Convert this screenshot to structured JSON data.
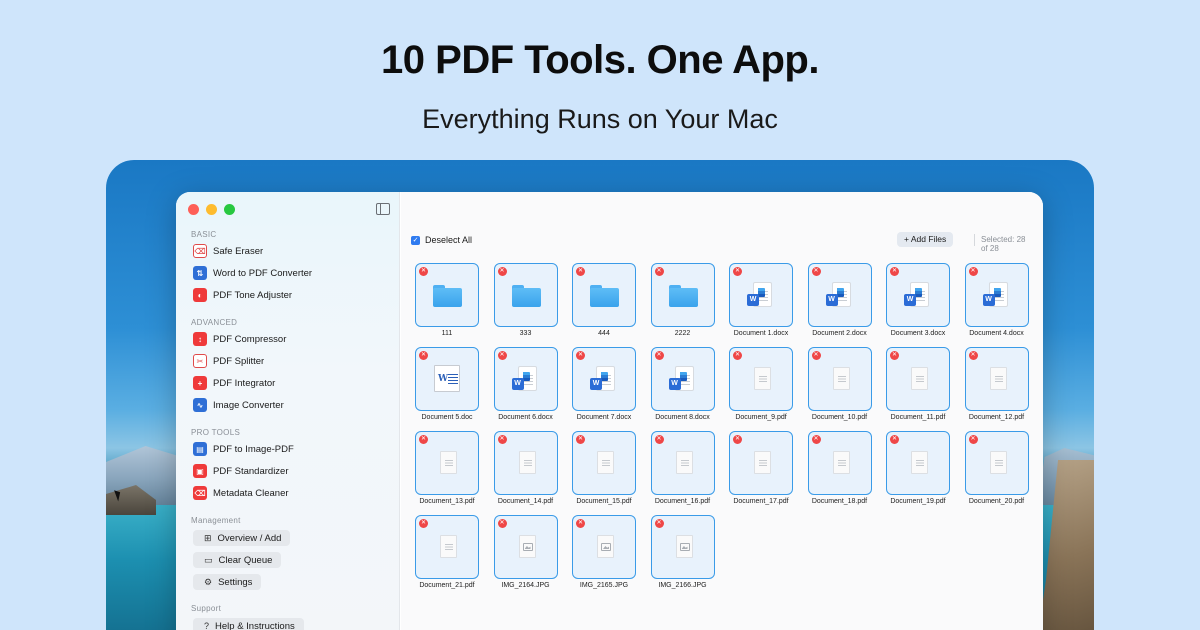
{
  "hero": {
    "title": "10 PDF Tools. One App.",
    "subtitle": "Everything Runs on Your Mac"
  },
  "sidebar": {
    "sections": {
      "basic": "BASIC",
      "advanced": "ADVANCED",
      "pro": "PRO TOOLS",
      "management": "Management",
      "support": "Support"
    },
    "basic_items": [
      {
        "label": "Safe Eraser",
        "icon": "eraser-icon"
      },
      {
        "label": "Word to PDF Converter",
        "icon": "word-convert-icon"
      },
      {
        "label": "PDF Tone Adjuster",
        "icon": "tone-icon"
      }
    ],
    "advanced_items": [
      {
        "label": "PDF Compressor",
        "icon": "compress-icon"
      },
      {
        "label": "PDF Splitter",
        "icon": "scissors-icon"
      },
      {
        "label": "PDF Integrator",
        "icon": "plus-icon"
      },
      {
        "label": "Image Converter",
        "icon": "image-icon"
      }
    ],
    "pro_items": [
      {
        "label": "PDF to Image-PDF",
        "icon": "image-pdf-icon"
      },
      {
        "label": "PDF Standardizer",
        "icon": "standard-icon"
      },
      {
        "label": "Metadata Cleaner",
        "icon": "eraser-icon"
      }
    ],
    "management_items": [
      {
        "label": "Overview / Add",
        "icon": "overview-icon"
      },
      {
        "label": "Clear Queue",
        "icon": "tray-icon"
      },
      {
        "label": "Settings",
        "icon": "gear-icon"
      }
    ],
    "support_items": [
      {
        "label": "Help & Instructions",
        "icon": "help-icon"
      }
    ]
  },
  "toolbar": {
    "deselect_label": "Deselect All",
    "add_files_label": "+ Add Files",
    "selected_count": "Selected: 28 of 28"
  },
  "files": [
    {
      "name": "111",
      "kind": "folder"
    },
    {
      "name": "333",
      "kind": "folder"
    },
    {
      "name": "444",
      "kind": "folder"
    },
    {
      "name": "2222",
      "kind": "folder"
    },
    {
      "name": "Document 1.docx",
      "kind": "docx"
    },
    {
      "name": "Document 2.docx",
      "kind": "docx"
    },
    {
      "name": "Document 3.docx",
      "kind": "docx"
    },
    {
      "name": "Document 4.docx",
      "kind": "docx"
    },
    {
      "name": "Document 5.doc",
      "kind": "doc"
    },
    {
      "name": "Document 6.docx",
      "kind": "docx"
    },
    {
      "name": "Document 7.docx",
      "kind": "docx"
    },
    {
      "name": "Document 8.docx",
      "kind": "docx"
    },
    {
      "name": "Document_9.pdf",
      "kind": "pdf"
    },
    {
      "name": "Document_10.pdf",
      "kind": "pdf"
    },
    {
      "name": "Document_11.pdf",
      "kind": "pdf"
    },
    {
      "name": "Document_12.pdf",
      "kind": "pdf"
    },
    {
      "name": "Document_13.pdf",
      "kind": "pdf"
    },
    {
      "name": "Document_14.pdf",
      "kind": "pdf"
    },
    {
      "name": "Document_15.pdf",
      "kind": "pdf"
    },
    {
      "name": "Document_16.pdf",
      "kind": "pdf"
    },
    {
      "name": "Document_17.pdf",
      "kind": "pdf"
    },
    {
      "name": "Document_18.pdf",
      "kind": "pdf"
    },
    {
      "name": "Document_19.pdf",
      "kind": "pdf"
    },
    {
      "name": "Document_20.pdf",
      "kind": "pdf"
    },
    {
      "name": "Document_21.pdf",
      "kind": "pdf"
    },
    {
      "name": "IMG_2164.JPG",
      "kind": "jpg"
    },
    {
      "name": "IMG_2165.JPG",
      "kind": "jpg"
    },
    {
      "name": "IMG_2166.JPG",
      "kind": "jpg"
    }
  ],
  "colors": {
    "page_bg": "#cfe5fb",
    "accent": "#3a9be8",
    "remove": "#ef4747",
    "tool_red": "#ef3a3a",
    "tool_blue": "#2f6fd6"
  }
}
